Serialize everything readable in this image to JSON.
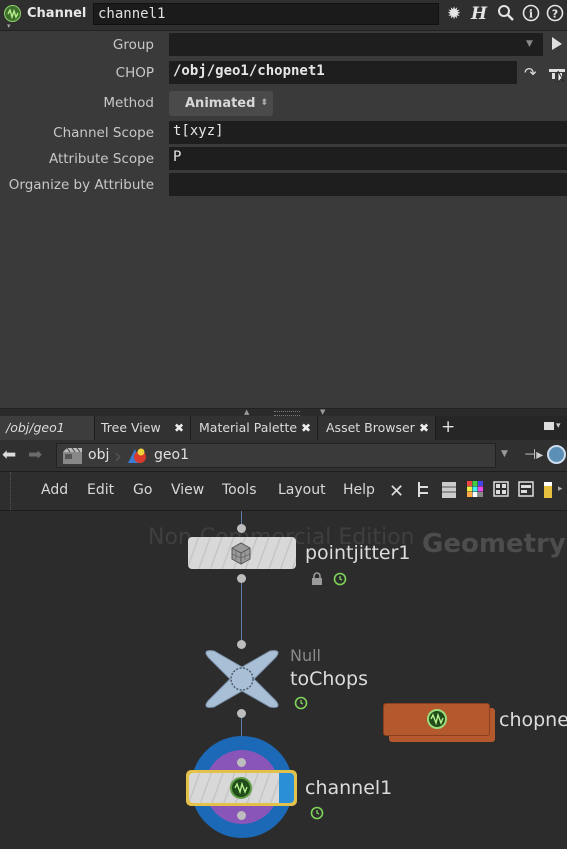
{
  "header": {
    "node_type_label": "Channel",
    "node_name": "channel1"
  },
  "params": {
    "group_label": "Group",
    "group_value": "",
    "chop_label": "CHOP",
    "chop_value": "/obj/geo1/chopnet1",
    "method_label": "Method",
    "method_value": "Animated",
    "channel_scope_label": "Channel Scope",
    "channel_scope_value": "t[xyz]",
    "attribute_scope_label": "Attribute Scope",
    "attribute_scope_value": "P",
    "organize_label": "Organize by Attribute",
    "organize_value": ""
  },
  "tabs": [
    {
      "label": "/obj/geo1"
    },
    {
      "label": "Tree View"
    },
    {
      "label": "Material Palette"
    },
    {
      "label": "Asset Browser"
    }
  ],
  "path": {
    "crumb1": "obj",
    "crumb2": "geo1"
  },
  "menu": [
    "Add",
    "Edit",
    "Go",
    "View",
    "Tools",
    "Layout",
    "Help"
  ],
  "network": {
    "watermark": "Non-Commercial Edition",
    "context_label": "Geometry",
    "nodes": {
      "pointjitter": "pointjitter1",
      "null_type": "Null",
      "null_name": "toChops",
      "chopnet": "chopne",
      "channel": "channel1"
    }
  },
  "colors": {
    "accent_blue": "#2a8fd6",
    "chop_orange": "#b4582d",
    "selected_yellow": "#e2c24a",
    "channel_icon_green": "#7fd45a"
  }
}
